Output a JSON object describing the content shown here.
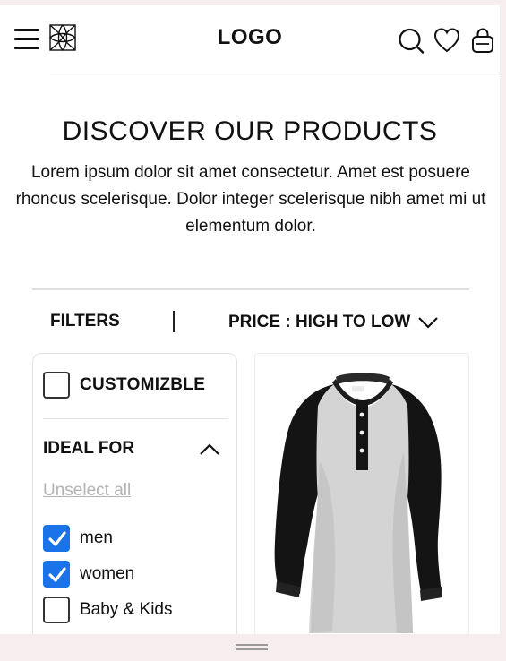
{
  "header": {
    "logo_text": "LOGO",
    "menu_icon": "hamburger-icon",
    "brand_icon": "ornament-icon",
    "search_icon": "search-icon",
    "wishlist_icon": "heart-icon",
    "bag_icon": "shopping-bag-icon"
  },
  "hero": {
    "title": "DISCOVER OUR PRODUCTS",
    "description": "Lorem ipsum dolor sit amet consectetur. Amet est posuere rhoncus scelerisque. Dolor integer scelerisque nibh amet mi ut elementum dolor."
  },
  "toolbar": {
    "filters_label": "FILTERS",
    "sort_label": "PRICE : HIGH TO LOW",
    "sort_icon": "chevron-down-icon"
  },
  "filters": {
    "customizable": {
      "label": "CUSTOMIZBLE",
      "checked": false
    },
    "ideal_for": {
      "heading": "IDEAL FOR",
      "expanded": true,
      "toggle_icon": "chevron-up-icon",
      "unselect_label": "Unselect all",
      "options": [
        {
          "label": "men",
          "checked": true
        },
        {
          "label": "women",
          "checked": true
        },
        {
          "label": "Baby & Kids",
          "checked": false
        }
      ]
    }
  },
  "colors": {
    "accent": "#1a73e8",
    "background": "#f6eeee",
    "muted_link": "#b3b3b3"
  }
}
